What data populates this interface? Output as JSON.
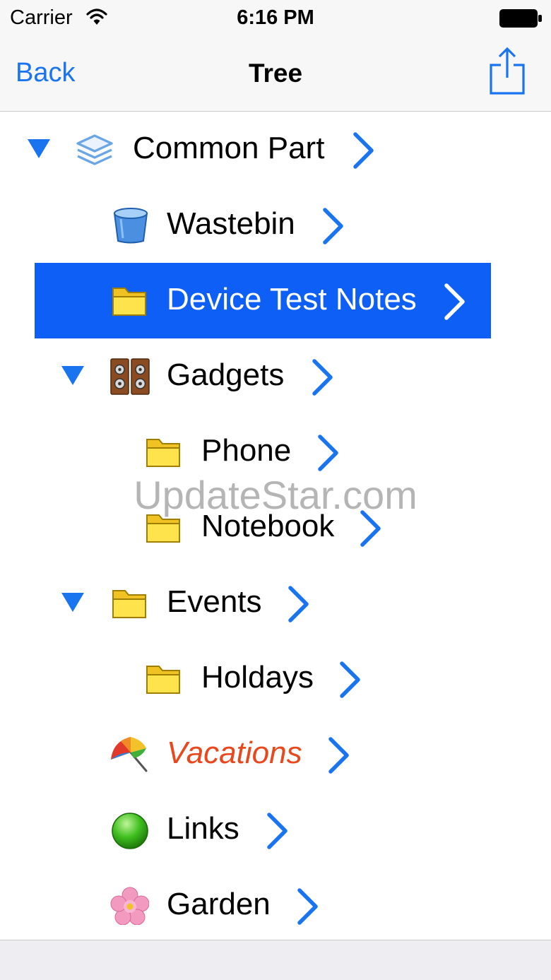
{
  "status": {
    "carrier": "Carrier",
    "time": "6:16 PM"
  },
  "nav": {
    "back_label": "Back",
    "title": "Tree",
    "share_icon": "share-icon"
  },
  "colors": {
    "accent": "#1a74f0",
    "selection": "#0e5ff5",
    "highlight_text": "#e8481c"
  },
  "tree": [
    {
      "label": "Common Part",
      "icon": "layers-icon",
      "level": 0,
      "expanded": true
    },
    {
      "label": "Wastebin",
      "icon": "wastebin-icon",
      "level": 1
    },
    {
      "label": "Device Test Notes",
      "icon": "folder-icon",
      "level": 1,
      "selected": true
    },
    {
      "label": "Gadgets",
      "icon": "speakers-icon",
      "level": 1,
      "expanded": true
    },
    {
      "label": "Phone",
      "icon": "folder-icon",
      "level": 2
    },
    {
      "label": "Notebook",
      "icon": "folder-icon",
      "level": 2
    },
    {
      "label": "Events",
      "icon": "folder-icon",
      "level": 1,
      "expanded": true
    },
    {
      "label": "Holdays",
      "icon": "folder-icon",
      "level": 2
    },
    {
      "label": "Vacations",
      "icon": "umbrella-icon",
      "level": 1,
      "style": "orange-italic"
    },
    {
      "label": "Links",
      "icon": "green-ball-icon",
      "level": 1
    },
    {
      "label": "Garden",
      "icon": "flower-icon",
      "level": 1
    }
  ],
  "watermark": "UpdateStar.com"
}
